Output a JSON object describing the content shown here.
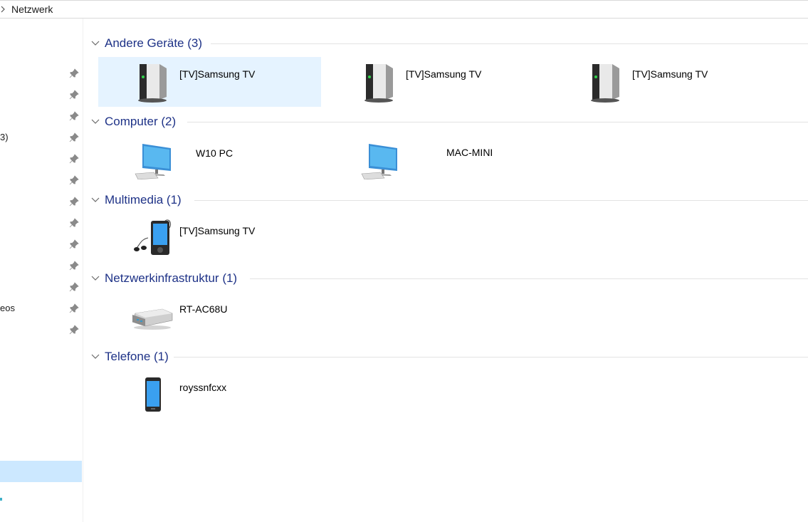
{
  "address": {
    "path": "Netzwerk"
  },
  "nav": {
    "partial_labels": [
      {
        "text": "3)"
      },
      {
        "text": "eos"
      }
    ]
  },
  "groups": [
    {
      "title": "Andere Geräte (3)",
      "items": [
        {
          "label": "[TV]Samsung TV",
          "icon": "server-icon",
          "selected": true
        },
        {
          "label": "[TV]Samsung TV",
          "icon": "server-icon"
        },
        {
          "label": "[TV]Samsung TV",
          "icon": "server-icon"
        }
      ]
    },
    {
      "title": "Computer (2)",
      "items": [
        {
          "label": "W10 PC",
          "icon": "computer-icon"
        },
        {
          "label": "MAC-MINI",
          "icon": "computer-icon"
        }
      ]
    },
    {
      "title": "Multimedia (1)",
      "items": [
        {
          "label": "[TV]Samsung TV",
          "icon": "media-player-icon"
        }
      ]
    },
    {
      "title": "Netzwerkinfrastruktur (1)",
      "items": [
        {
          "label": "RT-AC68U",
          "icon": "router-icon"
        }
      ]
    },
    {
      "title": "Telefone (1)",
      "items": [
        {
          "label": "royssnfcxx",
          "icon": "phone-icon"
        }
      ]
    }
  ],
  "colors": {
    "group_title": "#1e3287",
    "selection": "#e5f3ff",
    "nav_selection": "#cce8ff"
  }
}
